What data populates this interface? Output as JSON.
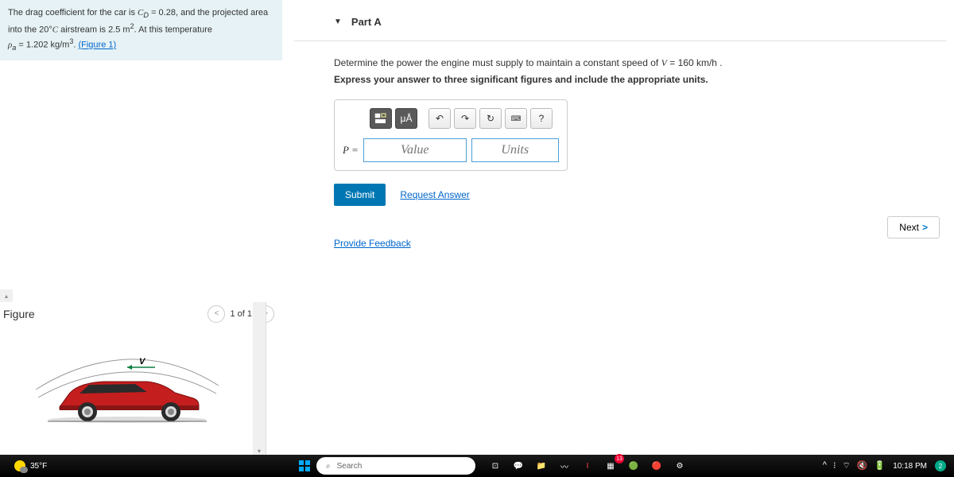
{
  "problem": {
    "text_prefix": "The drag coefficient for the car is ",
    "cd_var": "C",
    "cd_sub": "D",
    "cd_val": " = 0.28, and the projected area into the 20°",
    "temp_unit": "C",
    "area_text": " airstream is 2.5 m",
    "area_exp": "2",
    "area_suffix": ". At this temperature",
    "rho_var": "ρ",
    "rho_sub": "a",
    "rho_val": " = 1.202 kg/m",
    "rho_exp": "3",
    "rho_suffix": ". ",
    "figure_link": "(Figure 1)"
  },
  "figure": {
    "title": "Figure",
    "nav_text": "1 of 1",
    "v_label": "V"
  },
  "part": {
    "label": "Part A",
    "question": "Determine the power the engine must supply to maintain a constant speed of ",
    "v_var": "V",
    "v_val": " = 160  km/h .",
    "hint": "Express your answer to three significant figures and include the appropriate units."
  },
  "toolbar": {
    "template": "⊞",
    "special": "μÅ",
    "undo": "↶",
    "redo": "↷",
    "reset": "↻",
    "keyboard": "⌨",
    "help": "?"
  },
  "answer": {
    "label": "P = ",
    "value_placeholder": "Value",
    "units_placeholder": "Units"
  },
  "buttons": {
    "submit": "Submit",
    "request": "Request Answer",
    "feedback": "Provide Feedback",
    "next": "Next"
  },
  "taskbar": {
    "temp": "35°F",
    "search": "Search",
    "time": "10:18 PM",
    "badge": "13"
  }
}
